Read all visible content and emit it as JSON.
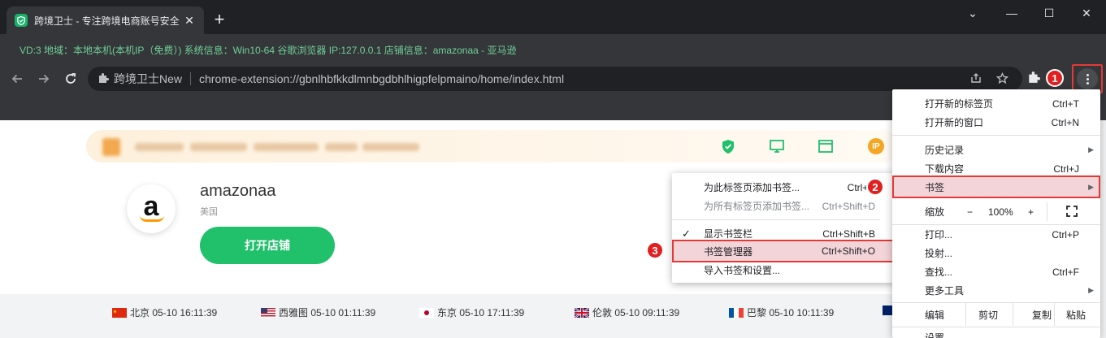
{
  "tab": {
    "title": "跨境卫士 - 专注跨境电商账号安全",
    "close": "✕",
    "new_tab": "+"
  },
  "window_controls": {
    "dropdown": "⌄",
    "minimize": "—",
    "maximize": "☐",
    "close": "✕"
  },
  "info_line": "VD:3 地域：本地本机(本机IP（免费）) 系统信息：Win10-64 谷歌浏览器 IP:127.0.0.1 店铺信息：amazonaa - 亚马逊",
  "omnibox": {
    "site_name": "跨境卫士New",
    "url": "chrome-extension://gbnlhbfkkdlmnbgdbhlhigpfelpmaino/home/index.html"
  },
  "banner": {
    "ip_label": "IP"
  },
  "shop": {
    "logo_letter": "a",
    "name": "amazonaa",
    "region": "美国",
    "open_button": "打开店铺"
  },
  "clocks": [
    {
      "flag": "china-flag",
      "text": "北京 05-10 16:11:39"
    },
    {
      "flag": "usa-flag",
      "text": "西雅图 05-10 01:11:39"
    },
    {
      "flag": "japan-flag",
      "text": "东京 05-10 17:11:39"
    },
    {
      "flag": "uk-flag",
      "text": "伦敦 05-10 09:11:39"
    },
    {
      "flag": "france-flag",
      "text": "巴黎 05-10 10:11:39"
    }
  ],
  "menu": {
    "new_tab": {
      "label": "打开新的标签页",
      "shortcut": "Ctrl+T"
    },
    "new_window": {
      "label": "打开新的窗口",
      "shortcut": "Ctrl+N"
    },
    "history": {
      "label": "历史记录"
    },
    "downloads": {
      "label": "下载内容",
      "shortcut": "Ctrl+J"
    },
    "bookmarks": {
      "label": "书签"
    },
    "zoom": {
      "label": "缩放",
      "minus": "−",
      "value": "100%",
      "plus": "+"
    },
    "print": {
      "label": "打印...",
      "shortcut": "Ctrl+P"
    },
    "cast": {
      "label": "投射..."
    },
    "find": {
      "label": "查找...",
      "shortcut": "Ctrl+F"
    },
    "more_tools": {
      "label": "更多工具"
    },
    "edit": {
      "label": "编辑",
      "cut": "剪切",
      "copy": "复制",
      "paste": "粘贴"
    },
    "settings": {
      "label": "设置"
    }
  },
  "bookmark_submenu": {
    "add_this": {
      "label": "为此标签页添加书签...",
      "shortcut": "Ctrl+D"
    },
    "add_all": {
      "label": "为所有标签页添加书签...",
      "shortcut": "Ctrl+Shift+D"
    },
    "show_bar": {
      "check": "✓",
      "label": "显示书签栏",
      "shortcut": "Ctrl+Shift+B"
    },
    "manager": {
      "label": "书签管理器",
      "shortcut": "Ctrl+Shift+O"
    },
    "import": {
      "label": "导入书签和设置..."
    }
  },
  "badges": {
    "one": "1",
    "two": "2",
    "three": "3"
  },
  "colors": {
    "accent_green": "#21c06b",
    "highlight_red": "#e53935",
    "badge_red": "#e02020",
    "info_green": "#6fcf97"
  }
}
